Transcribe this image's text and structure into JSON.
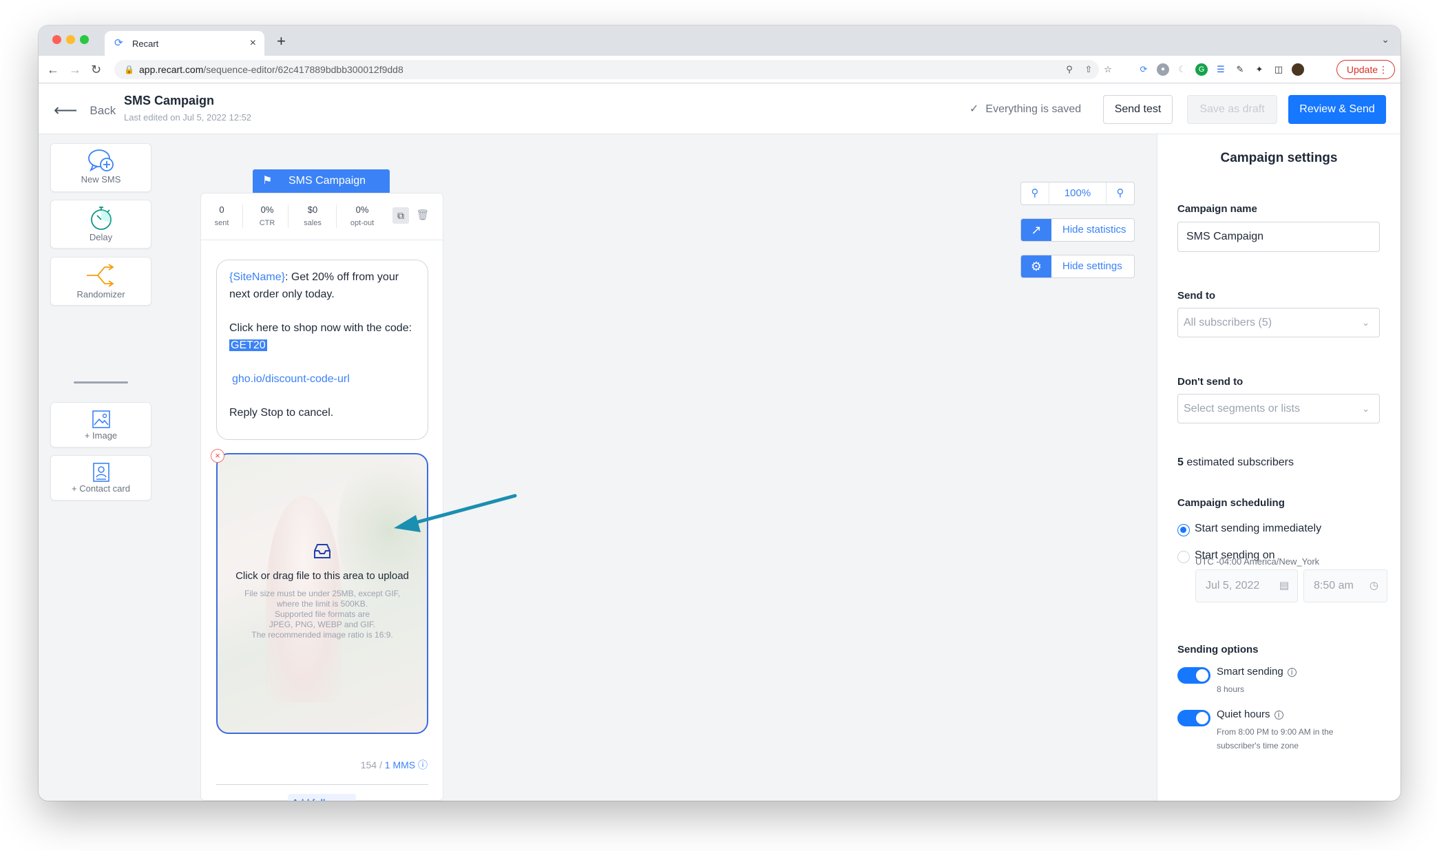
{
  "browser": {
    "tab_title": "Recart",
    "url_host": "app.recart.com",
    "url_path": "/sequence-editor/62c417889bdbb300012f9dd8",
    "update_label": "Update"
  },
  "header": {
    "back_label": "Back",
    "title": "SMS Campaign",
    "subtitle": "Last edited on Jul 5, 2022 12:52",
    "saved_status": "Everything is saved",
    "send_test": "Send test",
    "save_draft": "Save as draft",
    "review_send": "Review & Send"
  },
  "toolbox": [
    {
      "label": "New SMS",
      "icon": "new-sms-icon"
    },
    {
      "label": "Delay",
      "icon": "stopwatch-icon"
    },
    {
      "label": "Randomizer",
      "icon": "split-arrows-icon"
    },
    {
      "label": "+ Image",
      "icon": "image-icon"
    },
    {
      "label": "+ Contact card",
      "icon": "contact-card-icon"
    }
  ],
  "node": {
    "flag_label": "SMS Campaign",
    "stats": [
      {
        "value": "0",
        "label": "sent"
      },
      {
        "value": "0%",
        "label": "CTR"
      },
      {
        "value": "$0",
        "label": "sales"
      },
      {
        "value": "0%",
        "label": "opt-out"
      }
    ],
    "message": {
      "sitename": "{SiteName}",
      "line1_rest": ": Get 20% off from your next order only today.",
      "line2": "Click here to shop now with the code: ",
      "code": "GET20",
      "link": "gho.io/discount-code-url",
      "line4": "Reply Stop to cancel."
    },
    "upload": {
      "title": "Click or drag file to this area to upload",
      "hint1": "File size must be under 25MB, except GIF,",
      "hint2": "where the limit is 500KB.",
      "hint3": "Supported file formats are",
      "hint4": "JPEG, PNG, WEBP and GIF.",
      "hint5": "The recommended image ratio is 16:9."
    },
    "char_count": "154 /",
    "mms_label": "1 MMS",
    "follow_up": "Add follow-up"
  },
  "canvas_controls": {
    "zoom_value": "100%",
    "hide_statistics": "Hide statistics",
    "hide_settings": "Hide settings"
  },
  "settings": {
    "title": "Campaign settings",
    "campaign_name_label": "Campaign name",
    "campaign_name_value": "SMS Campaign",
    "send_to_label": "Send to",
    "send_to_value": "All subscribers (5)",
    "dont_send_label": "Don't send to",
    "dont_send_placeholder": "Select segments or lists",
    "estimate_count": "5",
    "estimate_text": "estimated subscribers",
    "scheduling_label": "Campaign scheduling",
    "option_immediate": "Start sending immediately",
    "option_on": "Start sending on",
    "timezone": "UTC -04:00 America/New_York",
    "date_value": "Jul 5, 2022",
    "time_value": "8:50 am",
    "sending_options_label": "Sending options",
    "smart_sending": "Smart sending",
    "smart_sending_sub": "8 hours",
    "quiet_hours": "Quiet hours",
    "quiet_sub1": "From 8:00 PM to 9:00 AM in the",
    "quiet_sub2": "subscriber's time zone"
  },
  "colors": {
    "accent": "#1677ff",
    "annotation_arrow": "#1a8fb0"
  }
}
